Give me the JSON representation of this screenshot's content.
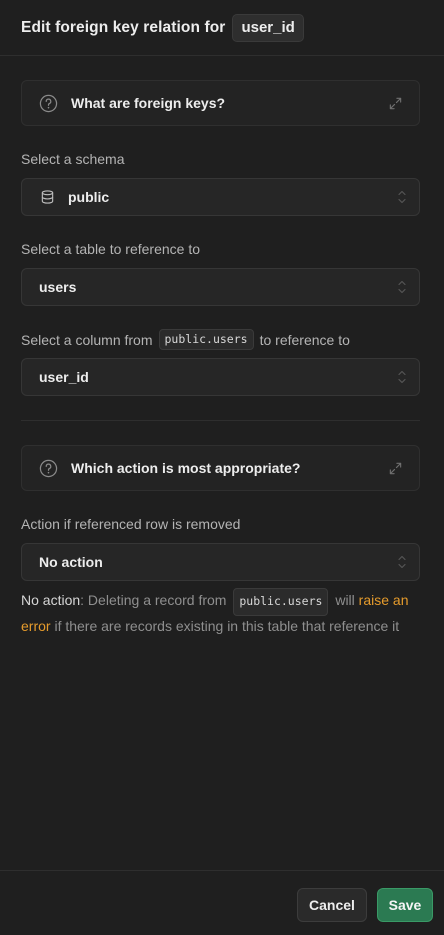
{
  "header": {
    "title": "Edit foreign key relation for",
    "column_chip": "user_id"
  },
  "accordion_foreign_keys": {
    "label": "What are foreign keys?",
    "icon": "question-circle-icon",
    "expand_icon": "expand-icon"
  },
  "schema": {
    "label": "Select a schema",
    "value": "public",
    "icon": "database-icon"
  },
  "table": {
    "label": "Select a table to reference to",
    "value": "users"
  },
  "column": {
    "label_prefix": "Select a column from",
    "label_code": "public.users",
    "label_suffix": "to reference to",
    "value": "user_id"
  },
  "accordion_action": {
    "label": "Which action is most appropriate?",
    "icon": "question-circle-icon",
    "expand_icon": "expand-icon"
  },
  "action": {
    "label": "Action if referenced row is removed",
    "value": "No action"
  },
  "description": {
    "strong": "No action",
    "text1": ": Deleting a record from",
    "code": "public.users",
    "text2": "will",
    "warn": "raise an error",
    "text3": "if there are records existing in this table that reference it"
  },
  "footer": {
    "cancel_label": "Cancel",
    "save_label": "Save"
  },
  "colors": {
    "background": "#1f1f1f",
    "save_button": "#2b7a52",
    "warning_text": "#e59b2c"
  }
}
